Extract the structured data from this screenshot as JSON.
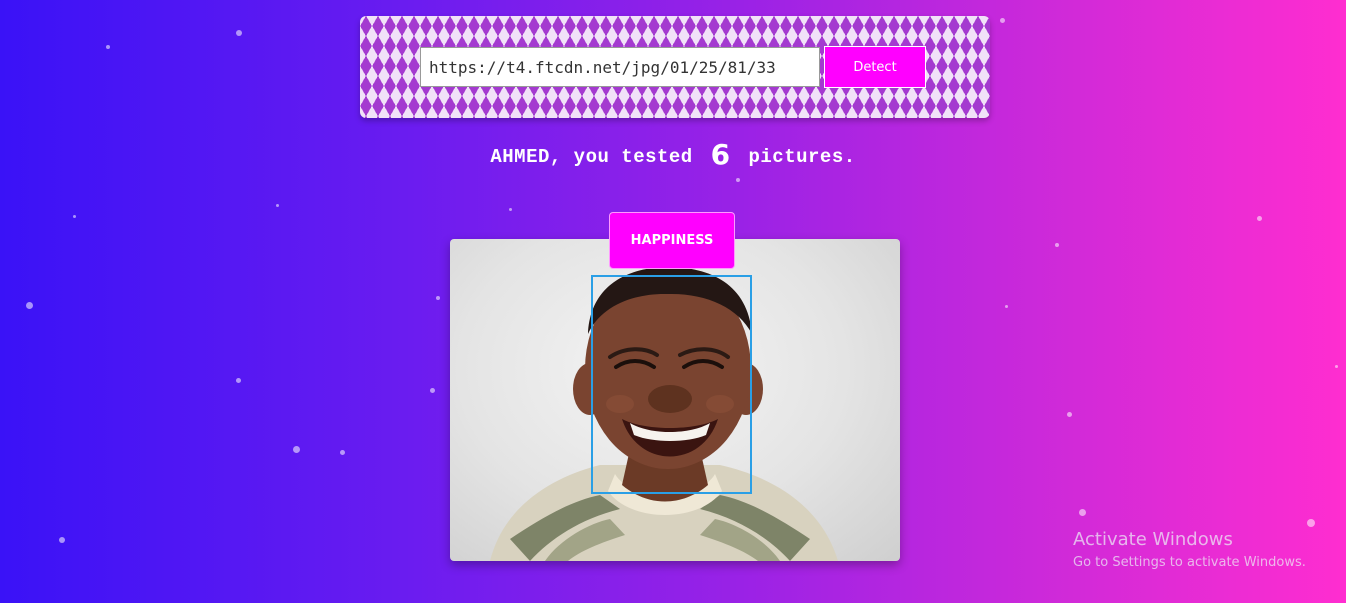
{
  "form": {
    "url_value": "https://t4.ftcdn.net/jpg/01/25/81/33",
    "detect_label": "Detect"
  },
  "greeting": {
    "name": "AHMED",
    "prefix_text": ", you tested",
    "count": "6",
    "suffix_text": "pictures."
  },
  "result": {
    "emotion_label": "HAPPINESS",
    "photo_alt": "Smiling child photo"
  },
  "watermark": {
    "title": "Activate Windows",
    "subtitle": "Go to Settings to activate Windows."
  },
  "colors": {
    "accent": "#ff00ff",
    "face_box": "#2a9fe6",
    "gradient_start": "#3a12f7",
    "gradient_end": "#ff2dd0"
  }
}
